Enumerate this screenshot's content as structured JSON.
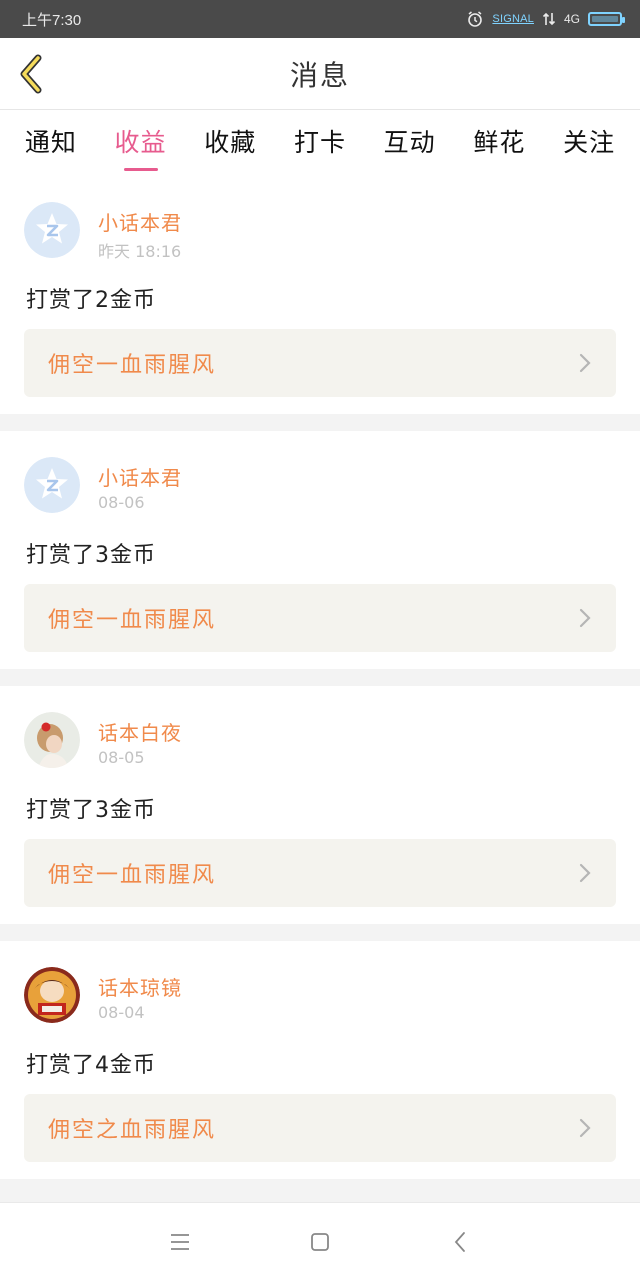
{
  "status": {
    "time": "上午7:30",
    "signal_label": "SIGNAL",
    "network": "4G"
  },
  "header": {
    "title": "消息"
  },
  "tabs": [
    {
      "label": "通知",
      "active": false
    },
    {
      "label": "收益",
      "active": true
    },
    {
      "label": "收藏",
      "active": false
    },
    {
      "label": "打卡",
      "active": false
    },
    {
      "label": "互动",
      "active": false
    },
    {
      "label": "鲜花",
      "active": false
    },
    {
      "label": "关注",
      "active": false
    }
  ],
  "messages": [
    {
      "name": "小话本君",
      "time": "昨天 18:16",
      "action": "打赏了2金币",
      "work": "佣空一血雨腥风",
      "avatar": "qq-default-icon"
    },
    {
      "name": "小话本君",
      "time": "08-06",
      "action": "打赏了3金币",
      "work": "佣空一血雨腥风",
      "avatar": "qq-default-icon"
    },
    {
      "name": "话本白夜",
      "time": "08-05",
      "action": "打赏了3金币",
      "work": "佣空一血雨腥风",
      "avatar": "user-photo-girl"
    },
    {
      "name": "话本琼镜",
      "time": "08-04",
      "action": "打赏了4金币",
      "work": "佣空之血雨腥风",
      "avatar": "user-photo-cartoon"
    }
  ],
  "colors": {
    "accent_pink": "#e75b8e",
    "name_orange": "#f08a4b",
    "card_bg": "#f4f3ee"
  }
}
